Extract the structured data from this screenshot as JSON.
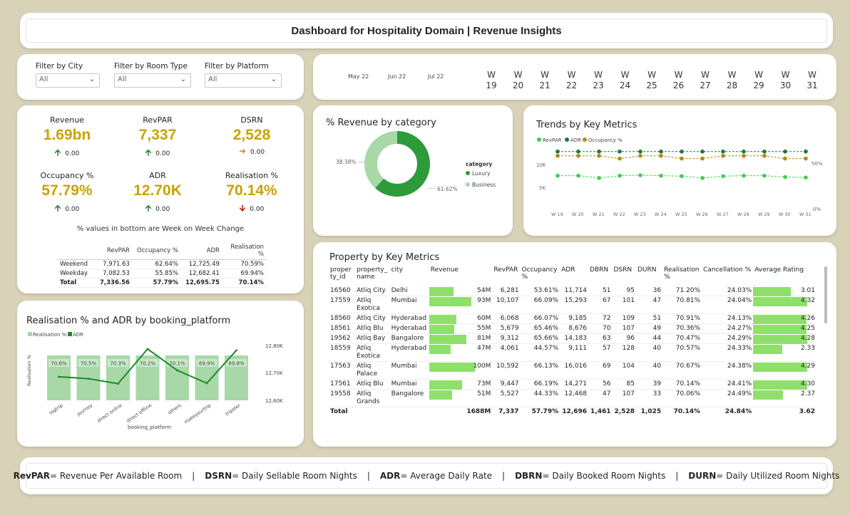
{
  "title": "Dashboard for Hospitality Domain | Revenue Insights",
  "filters": [
    {
      "label": "Filter by City",
      "value": "All"
    },
    {
      "label": "Filter by Room Type",
      "value": "All"
    },
    {
      "label": "Filter by Platform",
      "value": "All"
    }
  ],
  "timeline": {
    "months": [
      "May 22",
      "Jun 22",
      "Jul 22"
    ],
    "weeks": [
      "19",
      "20",
      "21",
      "22",
      "23",
      "24",
      "25",
      "26",
      "27",
      "28",
      "29",
      "30",
      "31"
    ],
    "week_prefix": "W"
  },
  "kpis": [
    {
      "label": "Revenue",
      "value": "1.69bn",
      "change": "0.00",
      "dir": "up"
    },
    {
      "label": "RevPAR",
      "value": "7,337",
      "change": "0.00",
      "dir": "up"
    },
    {
      "label": "DSRN",
      "value": "2,528",
      "change": "0.00",
      "dir": "right"
    },
    {
      "label": "Occupancy %",
      "value": "57.79%",
      "change": "0.00",
      "dir": "up"
    },
    {
      "label": "ADR",
      "value": "12.70K",
      "change": "0.00",
      "dir": "up"
    },
    {
      "label": "Realisation %",
      "value": "70.14%",
      "change": "0.00",
      "dir": "down"
    }
  ],
  "kpi_note": "% values in bottom are Week on Week Change",
  "day_table": {
    "headers": [
      "",
      "RevPAR",
      "Occupancy %",
      "ADR",
      "Realisation %"
    ],
    "rows": [
      [
        "Weekend",
        "7,971.63",
        "62.64%",
        "12,725.49",
        "70.59%"
      ],
      [
        "Weekday",
        "7,082.53",
        "55.85%",
        "12,682.41",
        "69.94%"
      ],
      [
        "Total",
        "7,336.56",
        "57.79%",
        "12,695.75",
        "70.14%"
      ]
    ]
  },
  "colors": {
    "accent": "#c9a300",
    "luxury": "#2e9b3a",
    "business": "#a8d8a8",
    "bar": "#8fe06a",
    "green": "#2e7d32"
  },
  "donut": {
    "title": "% Revenue by category",
    "legend_title": "category",
    "labels": [
      "38.38%",
      "61.62%"
    ]
  },
  "trends": {
    "title": "Trends by Key Metrics",
    "y_left": [
      "10K",
      "5K"
    ],
    "y_right": [
      "50%",
      "0%"
    ]
  },
  "realisation": {
    "title": "Realisation % and ADR by booking_platform",
    "ylabel": "Realisation %",
    "xlabel": "booking_platform",
    "y_right": [
      "12,80K",
      "12,70K",
      "12,60K"
    ]
  },
  "property": {
    "title": "Property by Key Metrics",
    "headers": [
      "proper ty_id",
      "property_ name",
      "city",
      "Revenue",
      "",
      "RevPAR",
      "Occupancy %",
      "ADR",
      "DBRN",
      "DSRN",
      "DURN",
      "Realisation %",
      "Cancellation %",
      "Average Rating"
    ],
    "rows": [
      {
        "id": "16560",
        "name": "Atliq City",
        "city": "Delhi",
        "revenue": "54M",
        "rev": 54,
        "revpar": "6,281",
        "occ": "53.61%",
        "adr": "11,714",
        "dbrn": "51",
        "dsrn": "95",
        "durn": "36",
        "real": "71.20%",
        "canc": "24.03%",
        "rating": "3.01",
        "rating_v": 3.01
      },
      {
        "id": "17559",
        "name": "Atliq Exotica",
        "city": "Mumbai",
        "revenue": "93M",
        "rev": 93,
        "revpar": "10,107",
        "occ": "66.09%",
        "adr": "15,293",
        "dbrn": "67",
        "dsrn": "101",
        "durn": "47",
        "real": "70.81%",
        "canc": "24.04%",
        "rating": "4.32",
        "rating_v": 4.32
      },
      {
        "id": "18560",
        "name": "Atliq City",
        "city": "Hyderabad",
        "revenue": "60M",
        "rev": 60,
        "revpar": "6,068",
        "occ": "66.07%",
        "adr": "9,185",
        "dbrn": "72",
        "dsrn": "109",
        "durn": "51",
        "real": "70.91%",
        "canc": "24.13%",
        "rating": "4.26",
        "rating_v": 4.26
      },
      {
        "id": "18561",
        "name": "Atliq Blu",
        "city": "Hyderabad",
        "revenue": "55M",
        "rev": 55,
        "revpar": "5,679",
        "occ": "65.46%",
        "adr": "8,676",
        "dbrn": "70",
        "dsrn": "107",
        "durn": "49",
        "real": "70.36%",
        "canc": "24.27%",
        "rating": "4.25",
        "rating_v": 4.25
      },
      {
        "id": "19562",
        "name": "Atliq Bay",
        "city": "Bangalore",
        "revenue": "81M",
        "rev": 81,
        "revpar": "9,312",
        "occ": "65.66%",
        "adr": "14,183",
        "dbrn": "63",
        "dsrn": "96",
        "durn": "44",
        "real": "70.47%",
        "canc": "24.29%",
        "rating": "4.28",
        "rating_v": 4.28
      },
      {
        "id": "18559",
        "name": "Atliq Exotica",
        "city": "Hyderabad",
        "revenue": "47M",
        "rev": 47,
        "revpar": "4,061",
        "occ": "44.57%",
        "adr": "9,111",
        "dbrn": "57",
        "dsrn": "128",
        "durn": "40",
        "real": "70.57%",
        "canc": "24.33%",
        "rating": "2.33",
        "rating_v": 2.33
      },
      {
        "id": "17563",
        "name": "Atliq Palace",
        "city": "Mumbai",
        "revenue": "100M",
        "rev": 100,
        "revpar": "10,592",
        "occ": "66.13%",
        "adr": "16,016",
        "dbrn": "69",
        "dsrn": "104",
        "durn": "40",
        "real": "70.67%",
        "canc": "24.38%",
        "rating": "4.29",
        "rating_v": 4.29
      },
      {
        "id": "17561",
        "name": "Atliq Blu",
        "city": "Mumbai",
        "revenue": "73M",
        "rev": 73,
        "revpar": "9,447",
        "occ": "66.19%",
        "adr": "14,271",
        "dbrn": "56",
        "dsrn": "85",
        "durn": "39",
        "real": "70.14%",
        "canc": "24.41%",
        "rating": "4.30",
        "rating_v": 4.3
      },
      {
        "id": "19558",
        "name": "Atliq Grands",
        "city": "Bangalore",
        "revenue": "51M",
        "rev": 51,
        "revpar": "5,527",
        "occ": "44.33%",
        "adr": "12,468",
        "dbrn": "47",
        "dsrn": "107",
        "durn": "33",
        "real": "70.06%",
        "canc": "24.49%",
        "rating": "2.37",
        "rating_v": 2.37
      }
    ],
    "total": {
      "label": "Total",
      "revenue": "1688M",
      "revpar": "7,337",
      "occ": "57.79%",
      "adr": "12,696",
      "dbrn": "1,461",
      "dsrn": "2,528",
      "durn": "1,025",
      "real": "70.14%",
      "canc": "24.84%",
      "rating": "3.62"
    }
  },
  "footer": [
    {
      "abbr": "RevPAR",
      "full": " = Revenue Per Available Room"
    },
    {
      "abbr": "DSRN",
      "full": " = Daily Sellable Room Nights"
    },
    {
      "abbr": "ADR",
      "full": " = Average Daily Rate"
    },
    {
      "abbr": "DBRN",
      "full": " = Daily Booked Room Nights"
    },
    {
      "abbr": "DURN",
      "full": " = Daily Utilized Room Nights"
    }
  ],
  "chart_data": [
    {
      "type": "pie",
      "title": "% Revenue by category",
      "legend_title": "category",
      "legend": "right",
      "categories": [
        "Luxury",
        "Business"
      ],
      "values": [
        61.62,
        38.38
      ]
    },
    {
      "type": "line",
      "title": "Trends by Key Metrics",
      "legend": "top-left",
      "x": [
        "W 19",
        "W 20",
        "W 21",
        "W 22",
        "W 23",
        "W 24",
        "W 25",
        "W 26",
        "W 27",
        "W 28",
        "W 29",
        "W 30",
        "W 31"
      ],
      "series": [
        {
          "name": "RevPAR",
          "axis": "left",
          "values": [
            7400,
            7400,
            6900,
            7400,
            7500,
            7400,
            7300,
            6900,
            7300,
            7400,
            7400,
            7100,
            7000
          ]
        },
        {
          "name": "ADR",
          "axis": "left",
          "values": [
            12700,
            12700,
            12700,
            12700,
            12700,
            12700,
            12700,
            12700,
            12700,
            12700,
            12700,
            12700,
            12700
          ]
        },
        {
          "name": "Occupancy %",
          "axis": "right",
          "values": [
            58,
            58,
            58,
            55,
            58,
            58,
            55,
            55,
            58,
            58,
            58,
            55,
            55
          ]
        }
      ],
      "y_left_ticks": [
        "10K",
        "5K"
      ],
      "y_right_ticks": [
        "50%",
        "0%"
      ],
      "grid": false
    },
    {
      "type": "bar",
      "title": "Realisation % and ADR by booking_platform",
      "xlabel": "booking_platform",
      "ylabel": "Realisation %",
      "legend": "top-left",
      "categories": [
        "logtrip",
        "journey",
        "direct online",
        "direct offline",
        "others",
        "makeyourtrip",
        "tripster"
      ],
      "series": [
        {
          "name": "Realisation %",
          "kind": "bar",
          "values": [
            70.6,
            70.5,
            70.3,
            70.2,
            70.1,
            69.9,
            69.8
          ]
        },
        {
          "name": "ADR",
          "kind": "line",
          "axis": "right",
          "values": [
            12690,
            12683,
            12665,
            12790,
            12713,
            12667,
            12785
          ]
        }
      ],
      "y_right_ticks": [
        "12,80K",
        "12,70K",
        "12,60K"
      ]
    }
  ]
}
